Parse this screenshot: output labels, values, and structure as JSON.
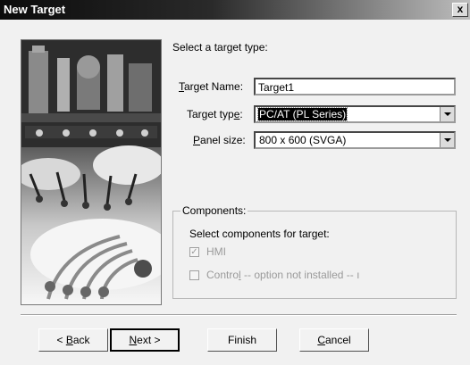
{
  "window": {
    "title": "New Target"
  },
  "title_bar": {
    "close_glyph": "x"
  },
  "illustration": {
    "icon": "industrial-factory-illustration"
  },
  "instruction": "Select a target type:",
  "fields": {
    "target_name": {
      "label_mnemonic": "T",
      "label_rest": "arget Name:",
      "value": "Target1"
    },
    "target_type": {
      "label_prefix": "Target typ",
      "label_mnemonic": "e",
      "label_suffix": ":",
      "value": "PC/AT (PL Series)"
    },
    "panel_size": {
      "label_mnemonic": "P",
      "label_rest": "anel size:",
      "value": "800 x 600 (SVGA)"
    }
  },
  "components": {
    "title": "Components:",
    "subtitle": "Select components for target:",
    "hmi": {
      "label": "HMI",
      "checked": true,
      "disabled": true
    },
    "control": {
      "label_prefix": "Contro",
      "label_mnemonic": "l",
      "label_suffix": " -- option not installed -- ı",
      "checked": false,
      "disabled": true
    }
  },
  "buttons": {
    "back": {
      "prefix": "< ",
      "mnemonic": "B",
      "rest": "ack"
    },
    "next": {
      "mnemonic": "N",
      "rest": "ext >"
    },
    "finish": {
      "label": "Finish"
    },
    "cancel": {
      "mnemonic": "C",
      "rest": "ancel"
    }
  },
  "colors": {
    "title_bar": "#0b0b0b",
    "dialog_bg": "#f1f1f1",
    "selection": "#000000"
  }
}
